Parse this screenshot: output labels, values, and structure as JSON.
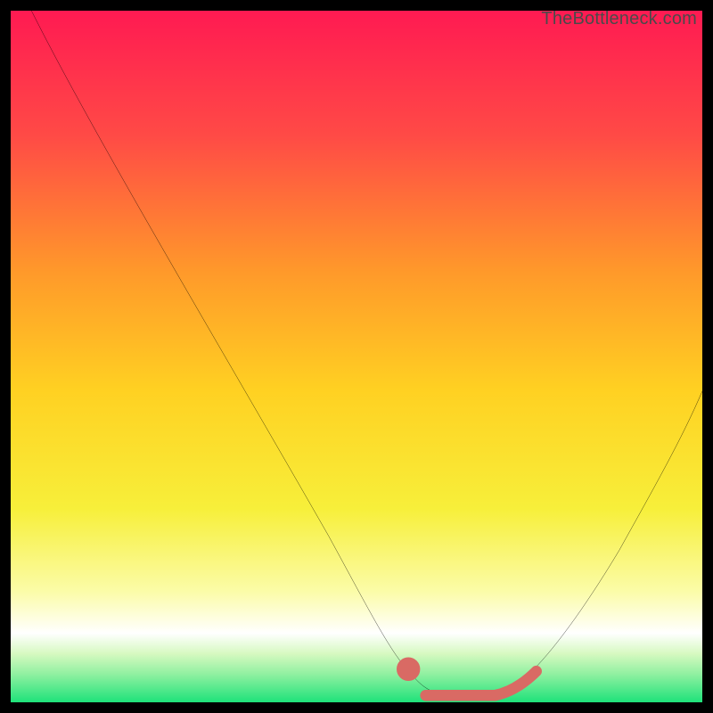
{
  "watermark": "TheBottleneck.com",
  "colors": {
    "top": "#ff1a52",
    "upper_mid": "#ff6e3a",
    "mid": "#ffd122",
    "lower_mid": "#f7f25a",
    "pale": "#fdfdd6",
    "green_light": "#b6f7a7",
    "green": "#1ee27a",
    "curve": "#000000",
    "marker": "#d96a64"
  },
  "chart_data": {
    "type": "line",
    "title": "",
    "xlabel": "",
    "ylabel": "",
    "xlim": [
      0,
      100
    ],
    "ylim": [
      0,
      100
    ],
    "series": [
      {
        "name": "bottleneck-curve",
        "x": [
          3,
          10,
          20,
          30,
          40,
          50,
          55,
          58,
          60,
          63,
          66,
          70,
          75,
          80,
          85,
          90,
          95,
          100
        ],
        "y": [
          100,
          87,
          71,
          55,
          39,
          23,
          13,
          6,
          3,
          1,
          1,
          1,
          2,
          8,
          16,
          25,
          35,
          45
        ]
      }
    ],
    "markers": [
      {
        "name": "highlight-dot",
        "x": 58,
        "y": 5.5
      },
      {
        "name": "highlight-flat",
        "x_range": [
          60,
          70
        ],
        "y": 1
      },
      {
        "name": "highlight-rise",
        "x_range": [
          70,
          76
        ],
        "y_range": [
          1,
          4
        ]
      }
    ]
  }
}
